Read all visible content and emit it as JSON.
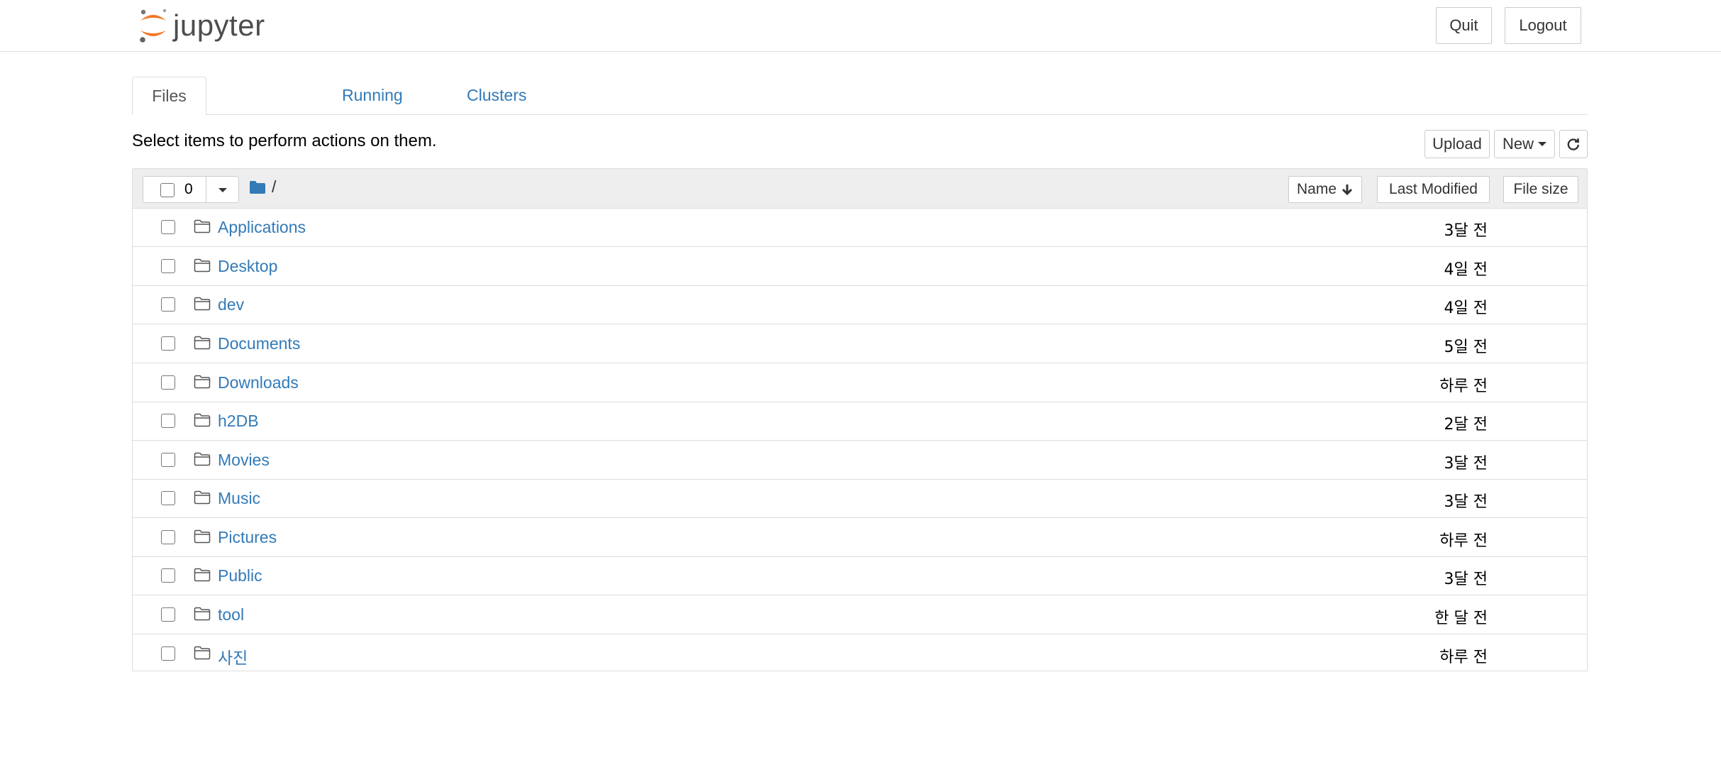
{
  "header": {
    "logo_text": "jupyter",
    "quit_label": "Quit",
    "logout_label": "Logout"
  },
  "tabs": [
    {
      "label": "Files",
      "active": true
    },
    {
      "label": "Running",
      "active": false
    },
    {
      "label": "Clusters",
      "active": false
    }
  ],
  "toolbar": {
    "hint": "Select items to perform actions on them.",
    "upload_label": "Upload",
    "new_label": "New",
    "refresh_icon": "refresh-icon"
  },
  "list_header": {
    "selected_count": "0",
    "path": "/",
    "sort_name_label": "Name",
    "sort_modified_label": "Last Modified",
    "sort_size_label": "File size"
  },
  "files": [
    {
      "name": "Applications",
      "modified": "3달 전"
    },
    {
      "name": "Desktop",
      "modified": "4일 전"
    },
    {
      "name": "dev",
      "modified": "4일 전"
    },
    {
      "name": "Documents",
      "modified": "5일 전"
    },
    {
      "name": "Downloads",
      "modified": "하루 전"
    },
    {
      "name": "h2DB",
      "modified": "2달 전"
    },
    {
      "name": "Movies",
      "modified": "3달 전"
    },
    {
      "name": "Music",
      "modified": "3달 전"
    },
    {
      "name": "Pictures",
      "modified": "하루 전"
    },
    {
      "name": "Public",
      "modified": "3달 전"
    },
    {
      "name": "tool",
      "modified": "한 달 전"
    },
    {
      "name": "사진",
      "modified": "하루 전"
    }
  ],
  "colors": {
    "link": "#337ab7",
    "logo_orange": "#f37726",
    "header_bg": "#eeeeee"
  }
}
